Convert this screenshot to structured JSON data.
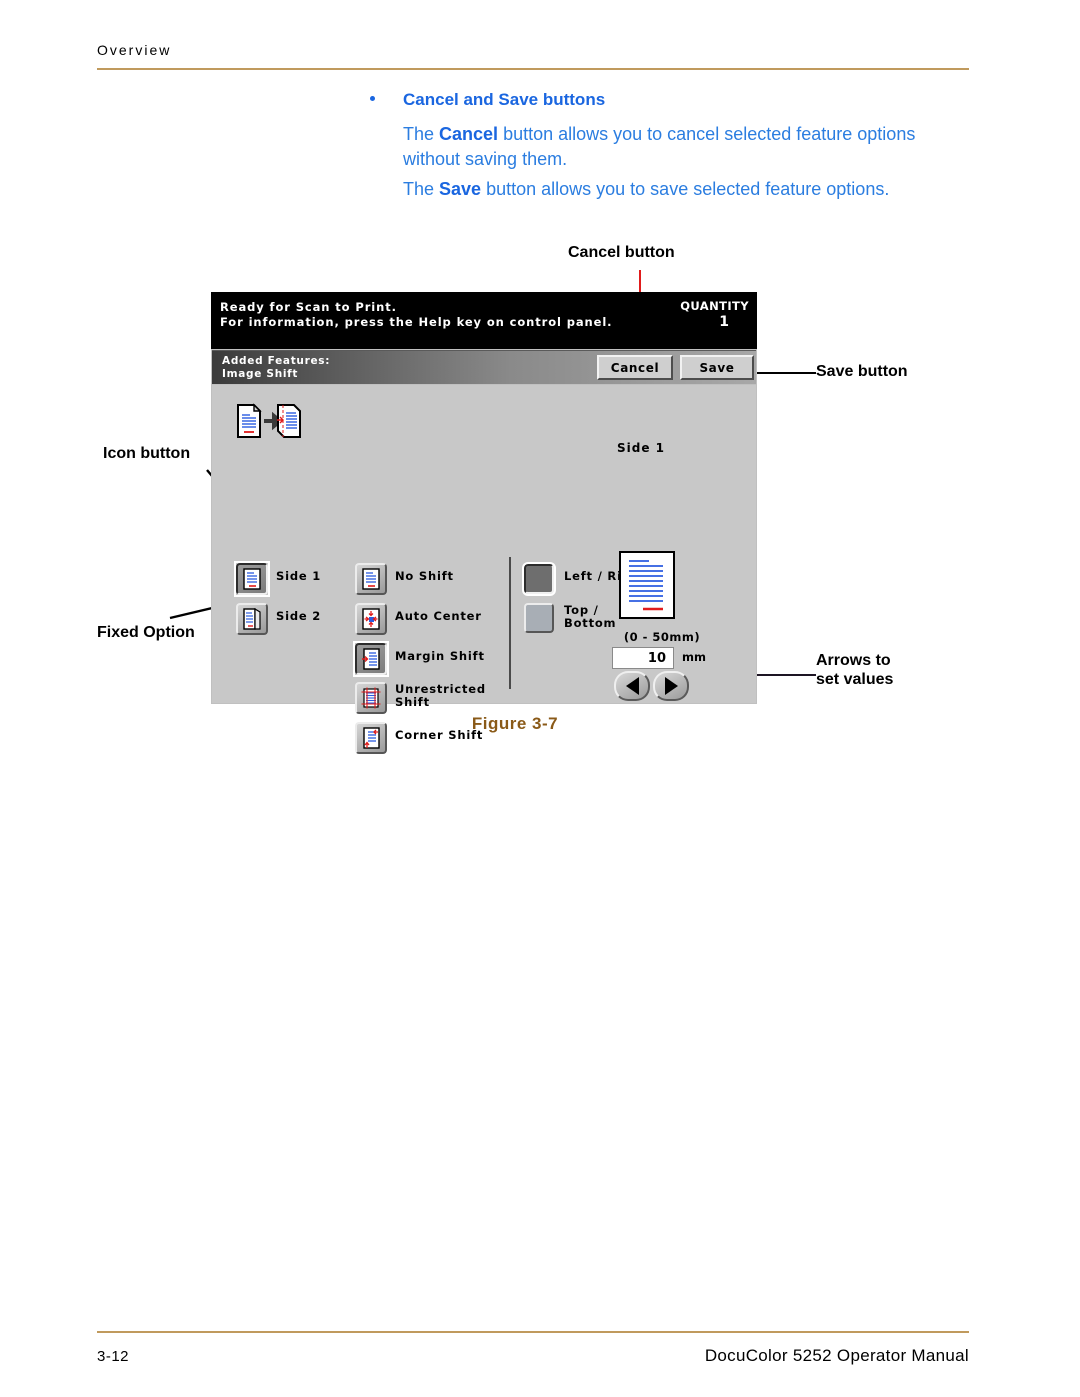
{
  "header": {
    "title": "Overview"
  },
  "footer": {
    "page_number": "3-12",
    "manual_title": "DocuColor 5252 Operator Manual"
  },
  "content": {
    "bullet_heading": "Cancel and Save buttons",
    "paragraph_1_pre": "The ",
    "paragraph_1_bold": "Cancel",
    "paragraph_1_post": " button allows you to cancel selected feature options without saving them.",
    "paragraph_2_pre": "The ",
    "paragraph_2_bold": "Save",
    "paragraph_2_post": " button allows you to save selected feature options."
  },
  "figure": {
    "caption": "Figure 3-7",
    "annotations": {
      "cancel_button": "Cancel button",
      "save_button": "Save button",
      "icon_button": "Icon button",
      "fixed_option": "Fixed Option",
      "arrows_to_set_values": "Arrows to\nset values",
      "arrows_line1": "Arrows to",
      "arrows_line2": "set values"
    },
    "ui": {
      "status": {
        "line1": "Ready for Scan to Print.",
        "line2": "For information, press the Help key on control panel.",
        "quantity_label": "QUANTITY",
        "quantity_value": "1"
      },
      "toolbar": {
        "added_features_label": "Added Features:",
        "feature_name": "Image Shift",
        "cancel_label": "Cancel",
        "save_label": "Save"
      },
      "side_column": [
        {
          "label": "Side 1",
          "selected": true
        },
        {
          "label": "Side 2",
          "selected": false
        }
      ],
      "shift_column": [
        {
          "label": "No Shift",
          "selected": false
        },
        {
          "label": "Auto Center",
          "selected": false
        },
        {
          "label": "Margin Shift",
          "selected": true
        },
        {
          "label": "Unrestricted Shift",
          "line1": "Unrestricted",
          "line2": "Shift",
          "selected": false
        },
        {
          "label": "Corner Shift",
          "selected": false
        }
      ],
      "direction_column": {
        "heading": "Side 1",
        "options": [
          {
            "label": "Left / Right",
            "selected": true
          },
          {
            "label": "Top / Bottom",
            "line1": "Top /",
            "line2": "Bottom",
            "selected": false
          }
        ]
      },
      "value_control": {
        "range_label": "(0 - 50mm)",
        "value": "10",
        "unit": "mm",
        "decrement_icon": "left-arrow-icon",
        "increment_icon": "right-arrow-icon"
      }
    }
  },
  "colors": {
    "rule": "#c09a5d",
    "body_text_blue": "#2b7de0",
    "heading_blue": "#1a66e0",
    "caption_brown": "#8a5a18",
    "leader_red": "#e01b1b"
  }
}
